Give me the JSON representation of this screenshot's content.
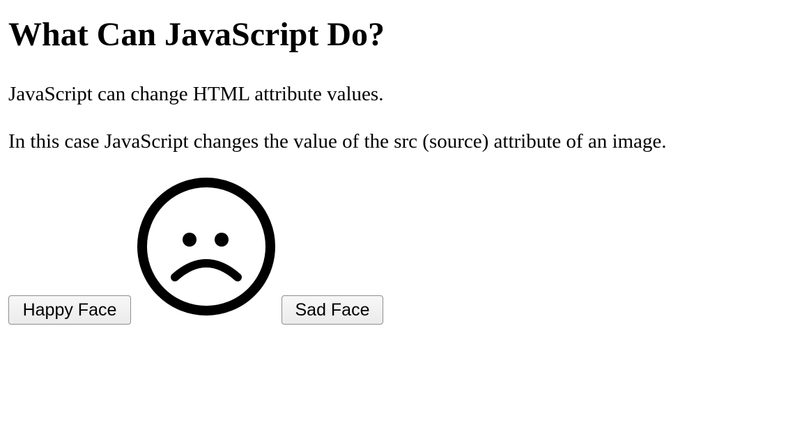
{
  "heading": "What Can JavaScript Do?",
  "paragraphs": {
    "first": "JavaScript can change HTML attribute values.",
    "second": "In this case JavaScript changes the value of the src (source) attribute of an image."
  },
  "buttons": {
    "happy": "Happy Face",
    "sad": "Sad Face"
  },
  "image": {
    "icon": "sad-face-icon"
  }
}
